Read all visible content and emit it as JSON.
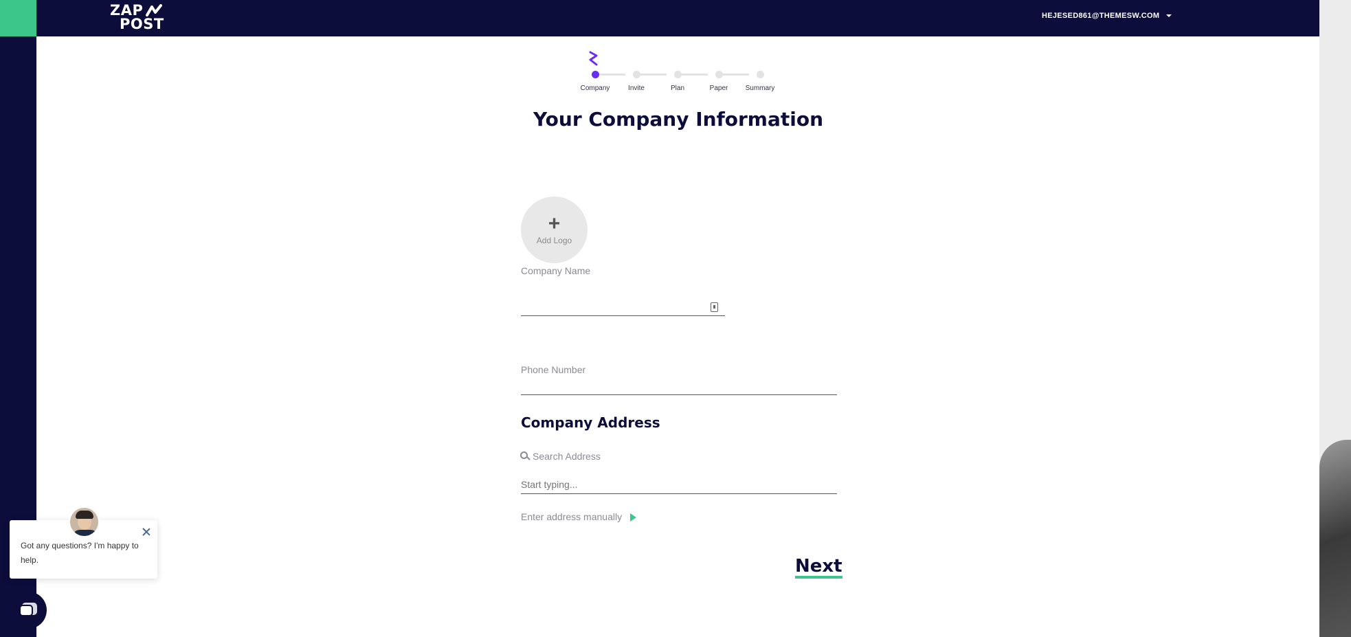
{
  "app": {
    "logo_line1": "ZAP",
    "logo_line2": "POST",
    "user_email": "HEJESED861@THEMESW.COM"
  },
  "stepper": {
    "steps": [
      {
        "label": "Company",
        "active": true
      },
      {
        "label": "Invite",
        "active": false
      },
      {
        "label": "Plan",
        "active": false
      },
      {
        "label": "Paper",
        "active": false
      },
      {
        "label": "Summary",
        "active": false
      }
    ]
  },
  "form": {
    "title": "Your Company Information",
    "add_logo_label": "Add Logo",
    "company_name_label": "Company Name",
    "company_name_value": "",
    "phone_label": "Phone Number",
    "phone_value": "",
    "address_heading": "Company Address",
    "search_address_label": "Search Address",
    "search_address_placeholder": "Start typing...",
    "manual_address_label": "Enter address manually",
    "next_label": "Next"
  },
  "chat": {
    "message": "Got any questions? I'm happy to help."
  },
  "colors": {
    "navy": "#0c0d3b",
    "green": "#3cc68a",
    "purple": "#6b2cf5"
  }
}
